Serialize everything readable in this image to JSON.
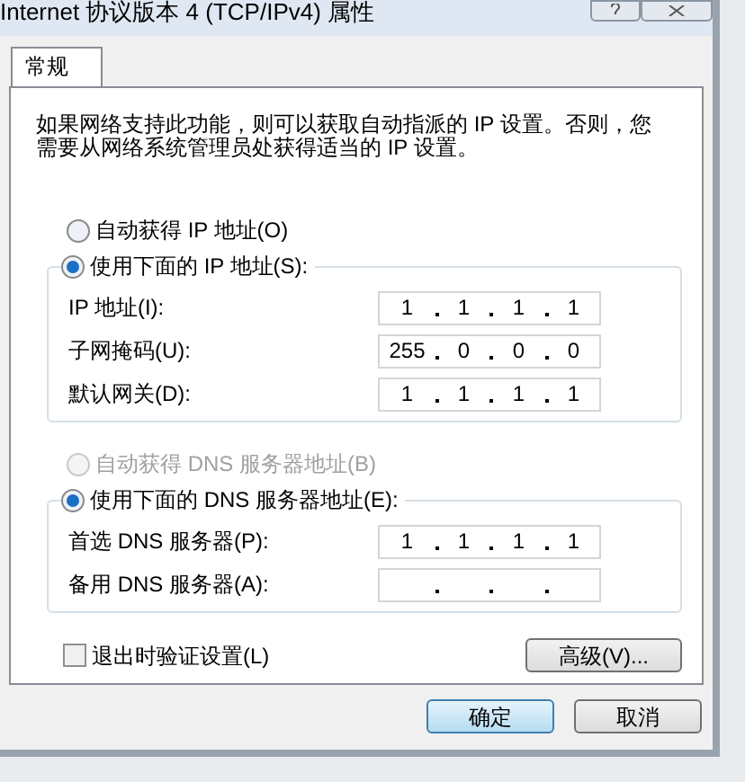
{
  "window": {
    "title": "Internet 协议版本 4 (TCP/IPv4) 属性"
  },
  "tabs": [
    {
      "label": "常规",
      "selected": true
    }
  ],
  "description": "如果网络支持此功能，则可以获取自动指派的 IP 设置。否则，您需要从网络系统管理员处获得适当的 IP 设置。",
  "ip_options": [
    {
      "label": "自动获得 IP 地址(O)",
      "selected": false,
      "disabled": false
    },
    {
      "label": "使用下面的 IP 地址(S):",
      "selected": true,
      "disabled": false
    }
  ],
  "ip_fields": [
    {
      "label": "IP 地址(I):",
      "octets": [
        "1",
        "1",
        "1",
        "1"
      ]
    },
    {
      "label": "子网掩码(U):",
      "octets": [
        "255",
        "0",
        "0",
        "0"
      ]
    },
    {
      "label": "默认网关(D):",
      "octets": [
        "1",
        "1",
        "1",
        "1"
      ]
    }
  ],
  "dns_options": [
    {
      "label": "自动获得 DNS 服务器地址(B)",
      "selected": false,
      "disabled": true
    },
    {
      "label": "使用下面的 DNS 服务器地址(E):",
      "selected": true,
      "disabled": false
    }
  ],
  "dns_fields": [
    {
      "label": "首选 DNS 服务器(P):",
      "octets": [
        "1",
        "1",
        "1",
        "1"
      ]
    },
    {
      "label": "备用 DNS 服务器(A):"
    }
  ],
  "validate_on_exit": {
    "label": "退出时验证设置(L)",
    "checked": false
  },
  "advanced_button": "高级(V)...",
  "buttons": [
    {
      "label": "确定",
      "default": true
    },
    {
      "label": "取消",
      "default": false
    }
  ]
}
